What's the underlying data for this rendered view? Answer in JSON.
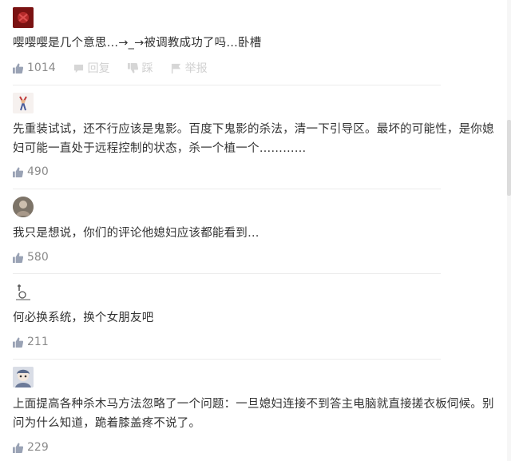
{
  "comments": [
    {
      "text": "嘤嘤嘤是几个意思…→_→被调教成功了吗…卧槽",
      "likes": "1014",
      "actions": {
        "reply": "回复",
        "dislike": "踩",
        "report": "举报"
      }
    },
    {
      "text": "先重装试试，还不行应该是鬼影。百度下鬼影的杀法，清一下引导区。最坏的可能性，是你媳妇可能一直处于远程控制的状态，杀一个植一个…………",
      "likes": "490"
    },
    {
      "text": "我只是想说，你们的评论他媳妇应该都能看到…",
      "likes": "580"
    },
    {
      "text": "何必换系统，换个女朋友吧",
      "likes": "211"
    },
    {
      "text": "上面提高各种杀木马方法忽略了一个问题：一旦媳妇连接不到答主电脑就直接搓衣板伺候。别问为什么知道，跪着膝盖疼不说了。",
      "likes": "229"
    }
  ],
  "colors": {
    "text": "#333333",
    "meta": "#8a8a8a",
    "divider": "#ececec",
    "faint": "#d0d0d0"
  }
}
